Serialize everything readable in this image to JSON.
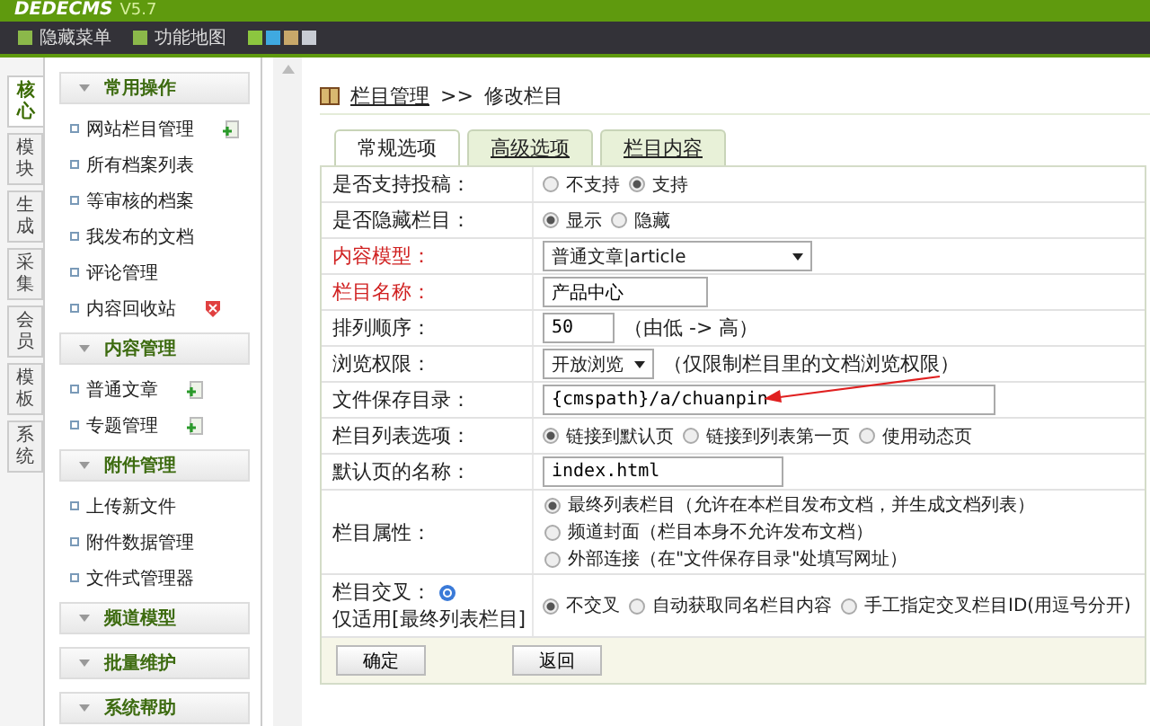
{
  "header": {
    "logo": "DEDECMS",
    "version": "V5.7"
  },
  "nav": {
    "items": [
      "隐藏菜单",
      "功能地图"
    ],
    "swatches": [
      {
        "color": "#8cc63f"
      },
      {
        "color": "#3fa9e0"
      },
      {
        "color": "#c8a86a"
      },
      {
        "color": "#c8ccd4"
      }
    ]
  },
  "side_tabs": [
    {
      "label": "核心",
      "selected": true
    },
    {
      "label": "模块",
      "selected": false
    },
    {
      "label": "生成",
      "selected": false
    },
    {
      "label": "采集",
      "selected": false
    },
    {
      "label": "会员",
      "selected": false
    },
    {
      "label": "模板",
      "selected": false
    },
    {
      "label": "系统",
      "selected": false
    }
  ],
  "menu": [
    {
      "title": "常用操作",
      "items": [
        {
          "label": "网站栏目管理",
          "addable": true
        },
        {
          "label": "所有档案列表"
        },
        {
          "label": "等审核的档案"
        },
        {
          "label": "我发布的文档"
        },
        {
          "label": "评论管理"
        },
        {
          "label": "内容回收站",
          "deletable": true
        }
      ]
    },
    {
      "title": "内容管理",
      "items": [
        {
          "label": "普通文章",
          "addable": true
        },
        {
          "label": "专题管理",
          "addable": true
        }
      ]
    },
    {
      "title": "附件管理",
      "items": [
        {
          "label": "上传新文件"
        },
        {
          "label": "附件数据管理"
        },
        {
          "label": "文件式管理器"
        }
      ]
    },
    {
      "title": "频道模型"
    },
    {
      "title": "批量维护"
    },
    {
      "title": "系统帮助"
    }
  ],
  "breadcrumb": {
    "link": "栏目管理",
    "separator": ">>",
    "current": "修改栏目"
  },
  "tabs": [
    {
      "label": "常规选项",
      "selected": true
    },
    {
      "label": "高级选项",
      "selected": false
    },
    {
      "label": "栏目内容",
      "selected": false
    }
  ],
  "form": [
    {
      "kind": "radio",
      "label": "是否支持投稿：",
      "required": false,
      "options": [
        {
          "label": "不支持",
          "selected": false
        },
        {
          "label": "支持",
          "selected": true
        }
      ]
    },
    {
      "kind": "radio",
      "label": "是否隐藏栏目：",
      "required": false,
      "options": [
        {
          "label": "显示",
          "selected": true
        },
        {
          "label": "隐藏",
          "selected": false
        }
      ]
    },
    {
      "kind": "select",
      "label": "内容模型：",
      "required": true,
      "value": "普通文章|article"
    },
    {
      "kind": "input",
      "label": "栏目名称：",
      "required": true,
      "value": "产品中心"
    },
    {
      "kind": "input",
      "label": "排列顺序：",
      "required": false,
      "value": "50",
      "hint": "（由低 -> 高）"
    },
    {
      "kind": "select",
      "label": "浏览权限：",
      "required": false,
      "value": "开放浏览",
      "hint": "（仅限制栏目里的文档浏览权限）"
    },
    {
      "kind": "input",
      "label": "文件保存目录：",
      "required": false,
      "value": "{cmspath}/a/chuanpin"
    },
    {
      "kind": "radio",
      "label": "栏目列表选项：",
      "required": false,
      "options": [
        {
          "label": "链接到默认页",
          "selected": true
        },
        {
          "label": "链接到列表第一页",
          "selected": false
        },
        {
          "label": "使用动态页",
          "selected": false
        }
      ]
    },
    {
      "kind": "input",
      "label": "默认页的名称：",
      "required": false,
      "value": "index.html"
    },
    {
      "kind": "stacked",
      "label": "栏目属性：",
      "required": false,
      "options": [
        {
          "label": "最终列表栏目（允许在本栏目发布文档，并生成文档列表）",
          "selected": true
        },
        {
          "label": "频道封面（栏目本身不允许发布文档）",
          "selected": false
        },
        {
          "label": "外部连接（在\"文件保存目录\"处填写网址）",
          "selected": false
        }
      ]
    },
    {
      "kind": "radio",
      "label": "栏目交叉：",
      "note": "仅适用[最终列表栏目]",
      "help": true,
      "required": false,
      "options": [
        {
          "label": "不交叉",
          "selected": true
        },
        {
          "label": "自动获取同名栏目内容",
          "selected": false
        },
        {
          "label": "手工指定交叉栏目ID(用逗号分开)",
          "selected": false
        }
      ]
    }
  ],
  "buttons": [
    "确定",
    "返回"
  ]
}
